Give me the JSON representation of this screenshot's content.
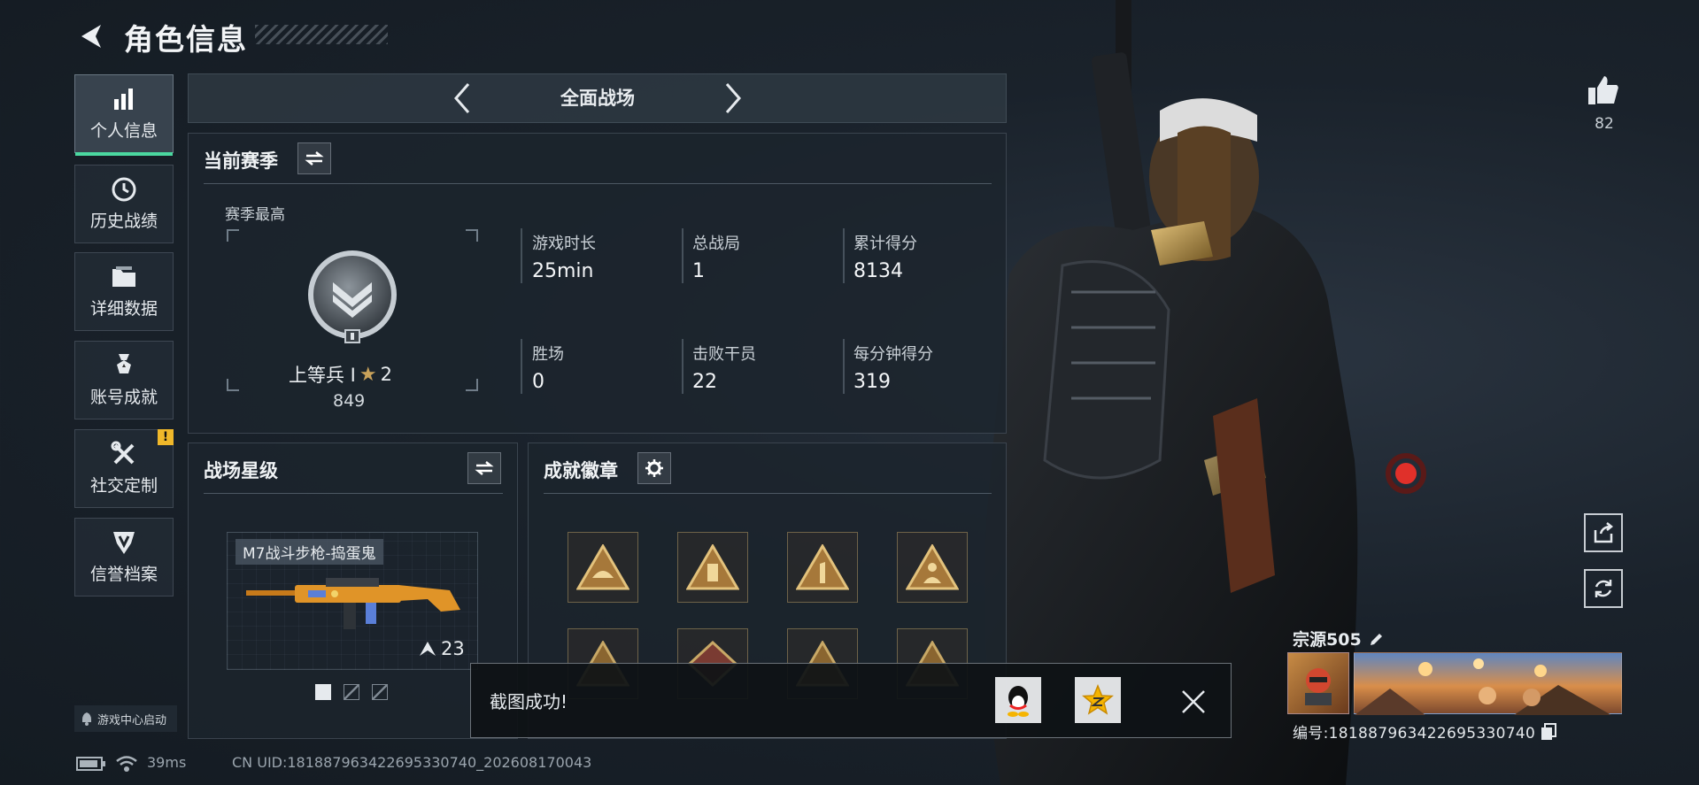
{
  "header": {
    "title": "角色信息"
  },
  "sidebar": {
    "items": [
      {
        "label": "个人信息",
        "icon": "bar-chart-icon",
        "active": true
      },
      {
        "label": "历史战绩",
        "icon": "clock-history-icon"
      },
      {
        "label": "详细数据",
        "icon": "folder-icon"
      },
      {
        "label": "账号成就",
        "icon": "medal-icon"
      },
      {
        "label": "社交定制",
        "icon": "tools-icon",
        "badge": "!"
      },
      {
        "label": "信誉档案",
        "icon": "shield-emblem-icon"
      }
    ]
  },
  "mode": {
    "title": "全面战场"
  },
  "season": {
    "title": "当前赛季",
    "best_label": "赛季最高",
    "rank_name": "上等兵 Ⅰ",
    "rank_stars": "2",
    "rank_points": "849",
    "stats": [
      {
        "label": "游戏时长",
        "value": "25min"
      },
      {
        "label": "总战局",
        "value": "1"
      },
      {
        "label": "累计得分",
        "value": "8134"
      },
      {
        "label": "胜场",
        "value": "0"
      },
      {
        "label": "击败干员",
        "value": "22"
      },
      {
        "label": "每分钟得分",
        "value": "319"
      }
    ]
  },
  "star_level": {
    "title": "战场星级",
    "weapon_name": "M7战斗步枪-捣蛋鬼",
    "weapon_level": "23"
  },
  "achievements": {
    "title": "成就徽章"
  },
  "toast": {
    "message": "截图成功!"
  },
  "right": {
    "likes": "82",
    "player_name": "宗源505",
    "player_id": "编号:1818879634226953307​40"
  },
  "footer": {
    "ping": "39ms",
    "uid": "CN UID:1818879634226953307​40_202608170043",
    "launch": "游戏中心启动"
  },
  "colors": {
    "accent": "#4bd8a0",
    "warning": "#f0b82a",
    "gold": "#c9a25a"
  }
}
